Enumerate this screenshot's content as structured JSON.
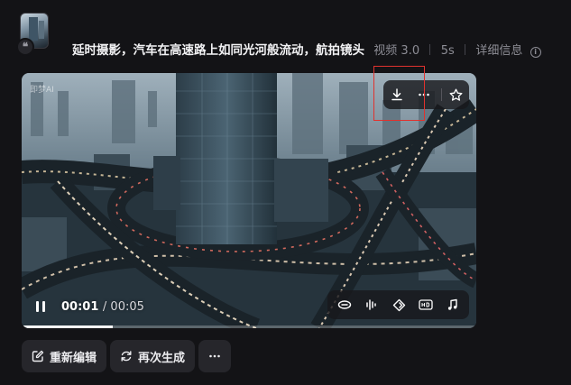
{
  "header": {
    "prompt": "延时摄影，汽车在高速路上如同光河般流动，航拍镜头",
    "model": "视频 3.0",
    "duration": "5s",
    "details_label": "详细信息"
  },
  "player": {
    "current_time": "00:01",
    "total_time": "/ 00:05",
    "progress_fraction": 0.2,
    "watermark_label": "即梦AI"
  },
  "actions": {
    "reedit_label": "重新编辑",
    "regenerate_label": "再次生成"
  },
  "colors": {
    "background": "#131316",
    "button_bg": "#26262b",
    "highlight_box": "#e0322e",
    "text_primary": "#f2f2f4",
    "text_meta": "#8d8d95"
  },
  "icons": {
    "download": "download-icon",
    "more": "more-icon",
    "favorite": "star-icon",
    "pause": "pause-icon",
    "loop": "loop-icon",
    "audio_wave": "audio-wave-icon",
    "frame": "frame-interpolation-icon",
    "hd": "hd-icon",
    "music": "music-icon",
    "edit": "edit-icon",
    "regenerate": "regenerate-icon",
    "info": "info-icon"
  }
}
